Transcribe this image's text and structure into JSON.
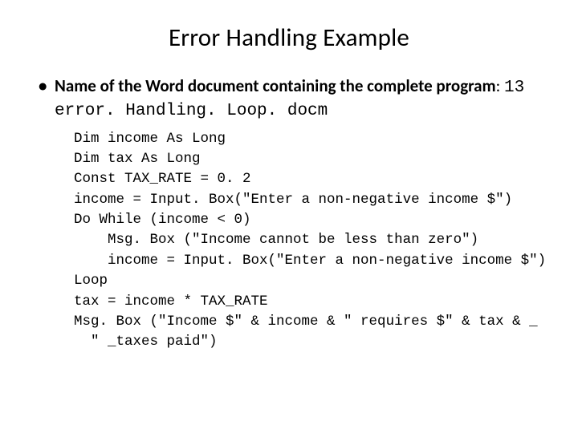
{
  "title": "Error Handling Example",
  "bullet": {
    "intro_bold": "Name of the Word document containing the complete program",
    "intro_sep": ": ",
    "filename": "13 error. Handling. Loop. docm"
  },
  "code": {
    "l01": "Dim income As Long",
    "l02": "Dim tax As Long",
    "l03": "Const TAX_RATE = 0. 2",
    "l04": "income = Input. Box(\"Enter a non-negative income $\")",
    "l05": "Do While (income < 0)",
    "l06": "    Msg. Box (\"Income cannot be less than zero\")",
    "l07": "    income = Input. Box(\"Enter a non-negative income $\")",
    "l08": "Loop",
    "l09": "tax = income * TAX_RATE",
    "l10": "Msg. Box (\"Income $\" & income & \" requires $\" & tax & _",
    "l11": "  \" _taxes paid\")"
  }
}
